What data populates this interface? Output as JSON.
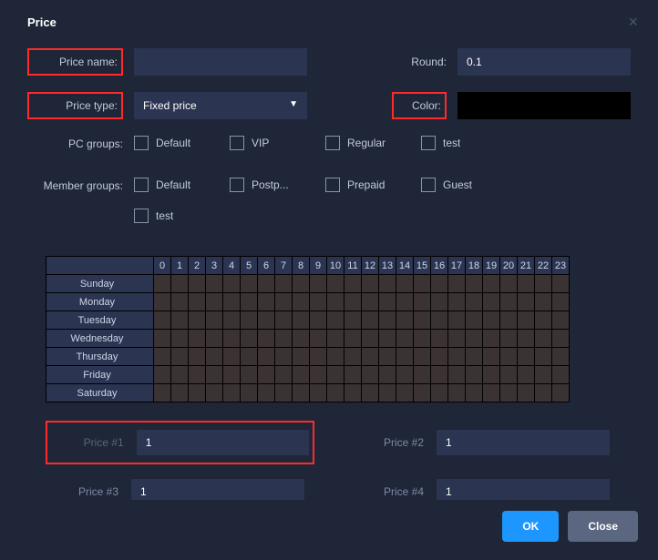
{
  "header": {
    "title": "Price"
  },
  "form": {
    "price_name": {
      "label": "Price name:",
      "value": ""
    },
    "round": {
      "label": "Round:",
      "value": "0.1"
    },
    "price_type": {
      "label": "Price type:",
      "value": "Fixed price"
    },
    "color": {
      "label": "Color:",
      "value": "#000000"
    },
    "pc_groups": {
      "label": "PC groups:",
      "items": [
        {
          "label": "Default",
          "checked": false
        },
        {
          "label": "VIP",
          "checked": false
        },
        {
          "label": "Regular",
          "checked": false
        },
        {
          "label": "test",
          "checked": false
        }
      ]
    },
    "member_groups": {
      "label": "Member groups:",
      "items": [
        {
          "label": "Default",
          "checked": false
        },
        {
          "label": "Postp...",
          "checked": false
        },
        {
          "label": "Prepaid",
          "checked": false
        },
        {
          "label": "Guest",
          "checked": false
        },
        {
          "label": "test",
          "checked": false
        }
      ]
    }
  },
  "schedule": {
    "hours": [
      "0",
      "1",
      "2",
      "3",
      "4",
      "5",
      "6",
      "7",
      "8",
      "9",
      "10",
      "11",
      "12",
      "13",
      "14",
      "15",
      "16",
      "17",
      "18",
      "19",
      "20",
      "21",
      "22",
      "23"
    ],
    "days": [
      "Sunday",
      "Monday",
      "Tuesday",
      "Wednesday",
      "Thursday",
      "Friday",
      "Saturday"
    ]
  },
  "prices": [
    {
      "label": "Price #1",
      "value": "1"
    },
    {
      "label": "Price #2",
      "value": "1"
    },
    {
      "label": "Price #3",
      "value": "1"
    },
    {
      "label": "Price #4",
      "value": "1"
    }
  ],
  "footer": {
    "ok": "OK",
    "close": "Close"
  }
}
